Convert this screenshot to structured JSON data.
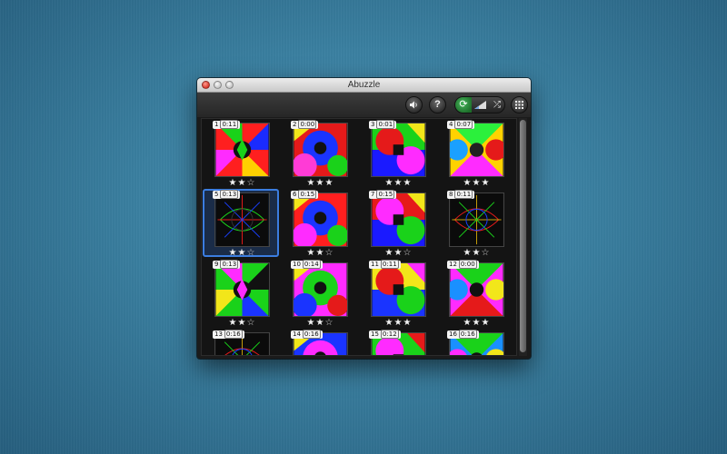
{
  "window": {
    "title": "Abuzzle"
  },
  "toolbar": {
    "sound": {
      "icon": "speaker-icon",
      "glyph": "◀)"
    },
    "help": {
      "icon": "help-icon",
      "glyph": "?"
    },
    "refresh": {
      "icon": "refresh-icon",
      "glyph": "⟳"
    },
    "difficulty": {
      "icon": "signal-icon"
    },
    "shuffle": {
      "icon": "shuffle-icon",
      "glyph": "⤮"
    },
    "grid": {
      "icon": "grid-icon"
    }
  },
  "puzzles": [
    {
      "number": "1",
      "time": "0:11",
      "stars": 2,
      "colors": [
        "#ff1f1f",
        "#19d219",
        "#1a2bff",
        "#ffd000",
        "#ff2bff",
        "#111"
      ]
    },
    {
      "number": "2",
      "time": "0:00",
      "stars": 3,
      "colors": [
        "#e51a1a",
        "#1a34ff",
        "#ff3bd6",
        "#1ad21a",
        "#f2e61a",
        "#111"
      ]
    },
    {
      "number": "3",
      "time": "0:01",
      "stars": 3,
      "colors": [
        "#1ad21a",
        "#1a1aff",
        "#e51a1a",
        "#ff2bff",
        "#f2e61a",
        "#111"
      ]
    },
    {
      "number": "4",
      "time": "0:07",
      "stars": 3,
      "colors": [
        "#ffd200",
        "#2bf03c",
        "#ff2bff",
        "#1aa0ff",
        "#e51a1a",
        "#222"
      ]
    },
    {
      "number": "5",
      "time": "0:13",
      "stars": 2,
      "colors": [
        "#0b0b0b",
        "#e51a1a",
        "#1ad21a",
        "#1a40ff",
        "#333",
        "#111"
      ]
    },
    {
      "number": "6",
      "time": "0:15",
      "stars": 2,
      "colors": [
        "#ff1f1f",
        "#1a34ff",
        "#ff2bff",
        "#1ad21a",
        "#f2e61a",
        "#111"
      ]
    },
    {
      "number": "7",
      "time": "0:15",
      "stars": 2,
      "colors": [
        "#e51a1a",
        "#1a1aff",
        "#ff2bff",
        "#1ad21a",
        "#f2e61a",
        "#111"
      ]
    },
    {
      "number": "8",
      "time": "0:11",
      "stars": 2,
      "colors": [
        "#0b0b0b",
        "#c8a00a",
        "#e51a1a",
        "#1ad21a",
        "#1a40ff",
        "#111"
      ]
    },
    {
      "number": "9",
      "time": "0:13",
      "stars": 2,
      "colors": [
        "#1ad21a",
        "#ff2bff",
        "#111",
        "#1a34ff",
        "#f2e61a",
        "#111"
      ]
    },
    {
      "number": "10",
      "time": "0:14",
      "stars": 2,
      "colors": [
        "#ff2bff",
        "#1ad21a",
        "#1a34ff",
        "#e51a1a",
        "#f2e61a",
        "#111"
      ]
    },
    {
      "number": "11",
      "time": "0:11",
      "stars": 3,
      "colors": [
        "#f2e61a",
        "#1a34ff",
        "#e51a1a",
        "#1ad21a",
        "#ff2bff",
        "#111"
      ]
    },
    {
      "number": "12",
      "time": "0:00",
      "stars": 3,
      "colors": [
        "#ff2bff",
        "#1ad21a",
        "#e51a1a",
        "#1a90ff",
        "#f2e61a",
        "#111"
      ]
    },
    {
      "number": "13",
      "time": "0:16",
      "stars": 0,
      "colors": [
        "#0b0b0b",
        "#c8a00a",
        "#e51a1a",
        "#1ad21a",
        "#1a40ff",
        "#111"
      ]
    },
    {
      "number": "14",
      "time": "0:16",
      "stars": 0,
      "colors": [
        "#1a34ff",
        "#ff2bff",
        "#e51a1a",
        "#1ad21a",
        "#f2e61a",
        "#111"
      ]
    },
    {
      "number": "15",
      "time": "0:12",
      "stars": 0,
      "colors": [
        "#1ad21a",
        "#f2e61a",
        "#ff2bff",
        "#1a34ff",
        "#e51a1a",
        "#111"
      ]
    },
    {
      "number": "16",
      "time": "0:16",
      "stars": 0,
      "colors": [
        "#1a90ff",
        "#1ad21a",
        "#e51a1a",
        "#ff2bff",
        "#f2e61a",
        "#111"
      ]
    }
  ],
  "selected": "5",
  "max_stars": 3
}
